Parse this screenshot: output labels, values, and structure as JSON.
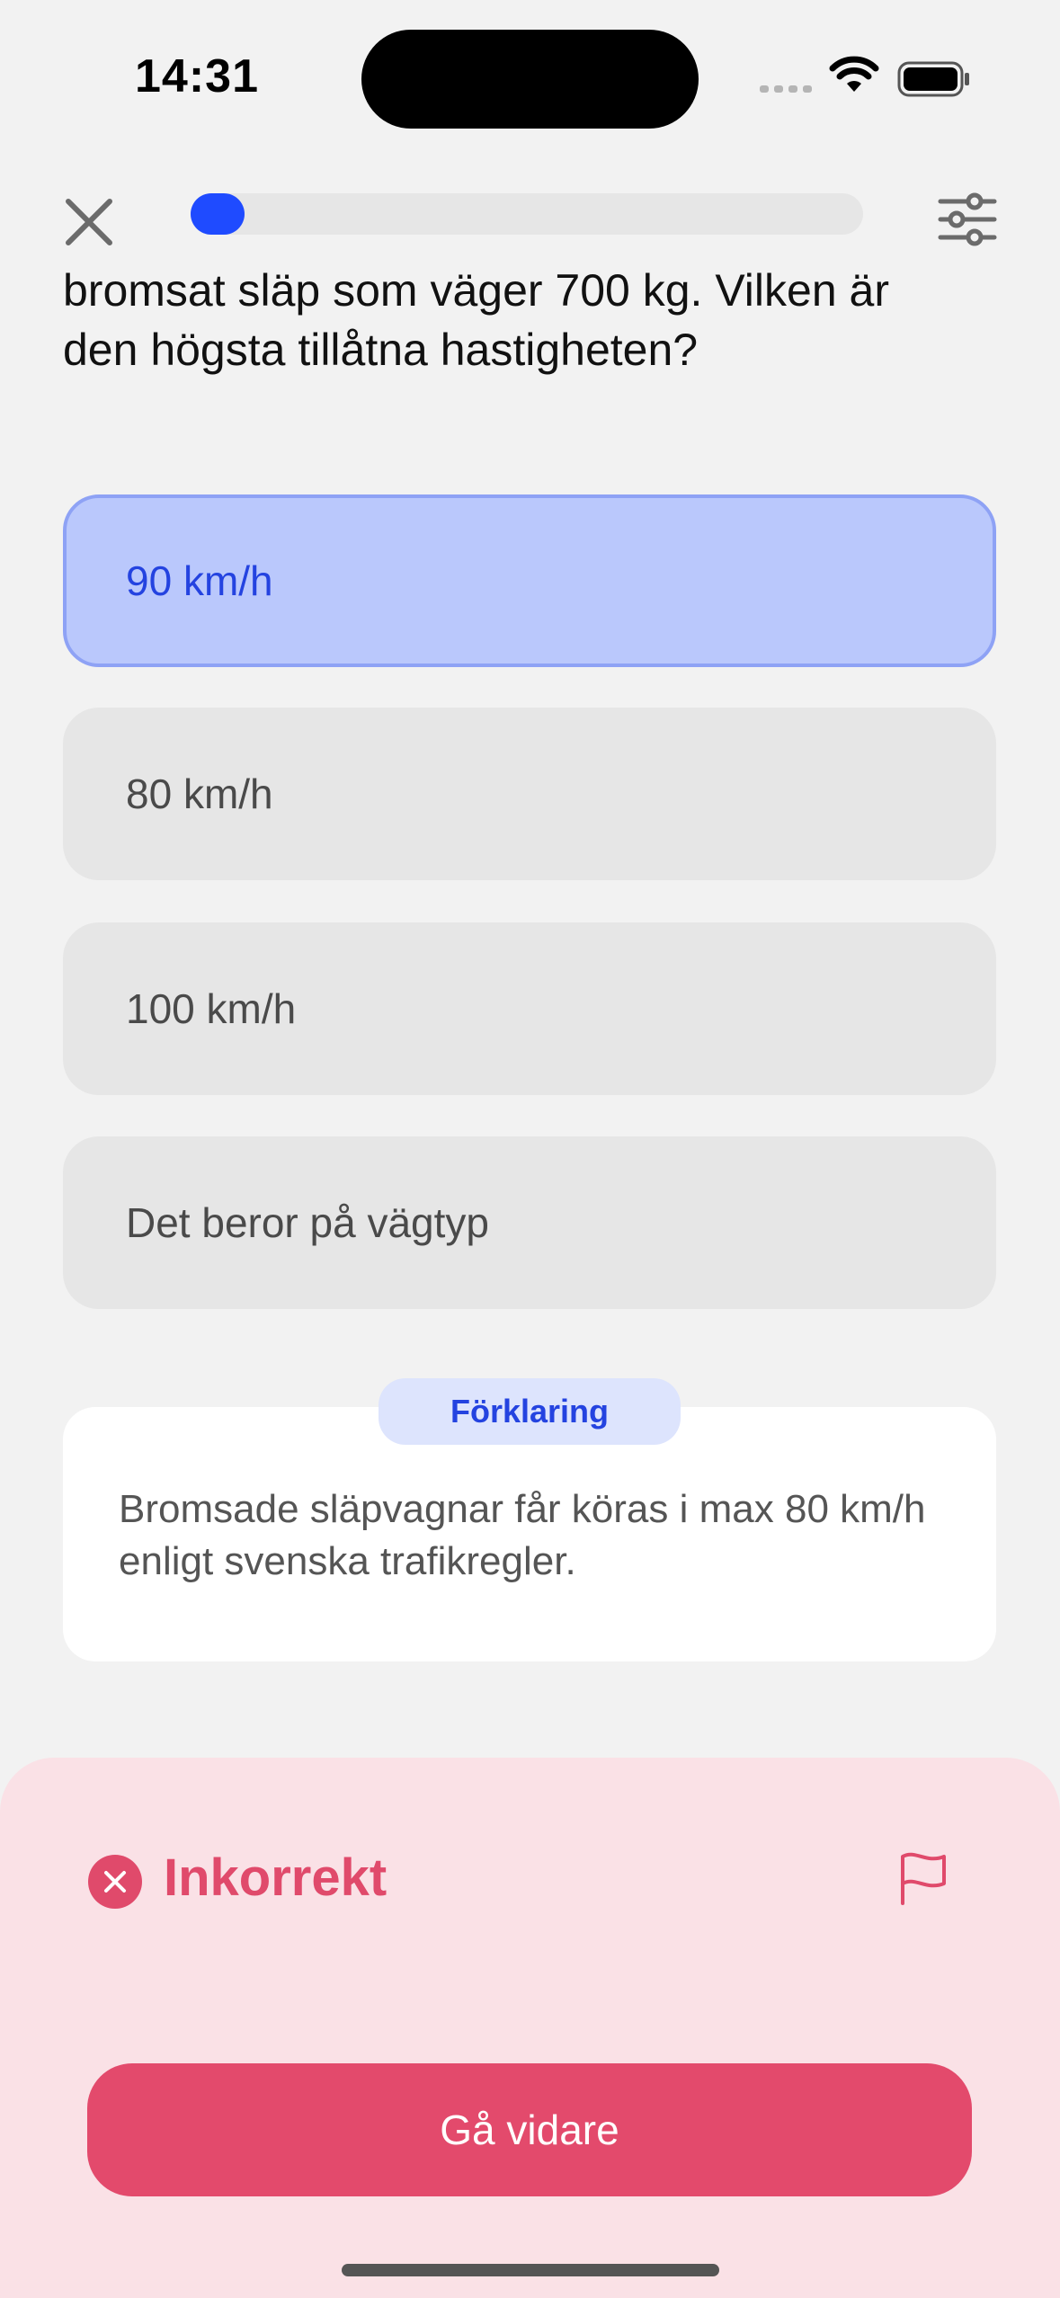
{
  "status_bar": {
    "time": "14:31"
  },
  "progress": {
    "fraction": 0.08
  },
  "question": {
    "text_line1": "bromsat släp som väger 700 kg. Vilken är",
    "text_line2": "den högsta tillåtna hastigheten?"
  },
  "options": [
    {
      "label": "90 km/h",
      "selected": true
    },
    {
      "label": "80 km/h",
      "selected": false
    },
    {
      "label": "100 km/h",
      "selected": false
    },
    {
      "label": "Det beror på vägtyp",
      "selected": false
    }
  ],
  "explanation": {
    "tag": "Förklaring",
    "text": "Bromsade släpvagnar får köras i max 80 km/h enligt svenska trafikregler."
  },
  "feedback": {
    "status": "Inkorrekt",
    "continue_label": "Gå vidare"
  },
  "colors": {
    "accent": "#1f4bff",
    "error": "#e34a6c",
    "error_bg": "#fae1e6",
    "selected_bg": "#bac8fc"
  },
  "icons": {
    "close": "close-icon",
    "settings": "sliders-icon",
    "result": "x-circle-icon",
    "report": "flag-icon"
  }
}
